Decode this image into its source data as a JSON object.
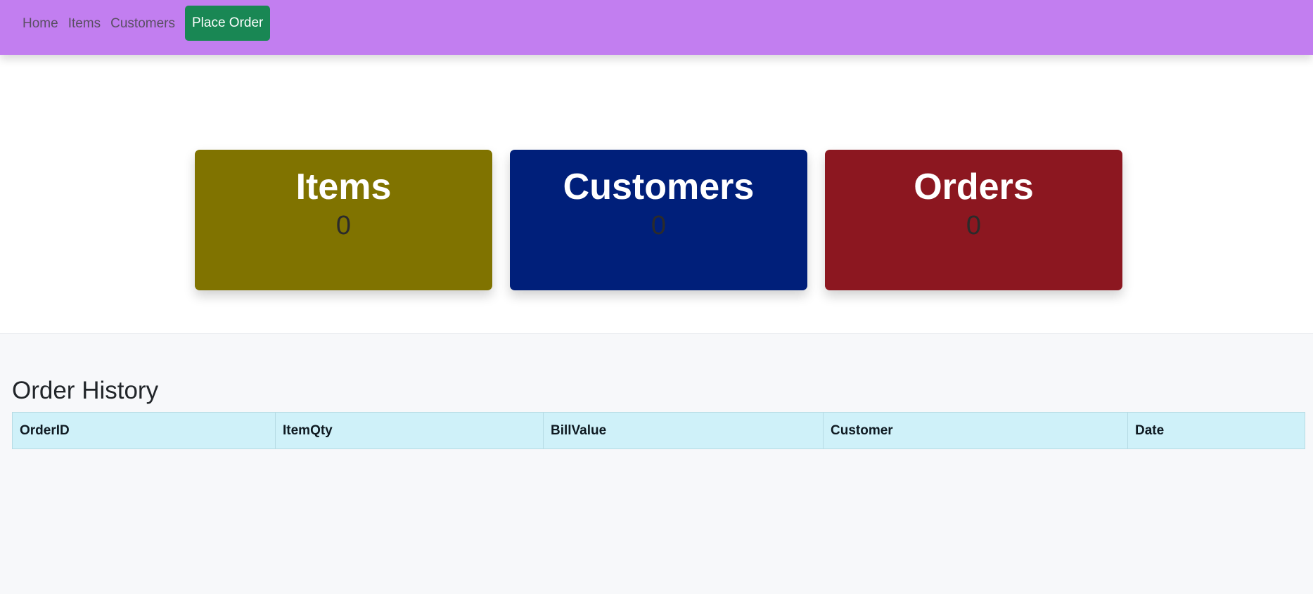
{
  "nav": {
    "links": [
      "Home",
      "Items",
      "Customers"
    ],
    "place_order_label": "Place Order",
    "colors": {
      "bar": "#c27ef0",
      "button": "#198754"
    }
  },
  "cards": [
    {
      "title": "Items",
      "value": "0",
      "color": "#807300"
    },
    {
      "title": "Customers",
      "value": "0",
      "color": "#001f7a"
    },
    {
      "title": "Orders",
      "value": "0",
      "color": "#8c1720"
    }
  ],
  "history": {
    "title": "Order History",
    "columns": [
      "OrderID",
      "ItemQty",
      "BillValue",
      "Customer",
      "Date"
    ],
    "rows": []
  }
}
